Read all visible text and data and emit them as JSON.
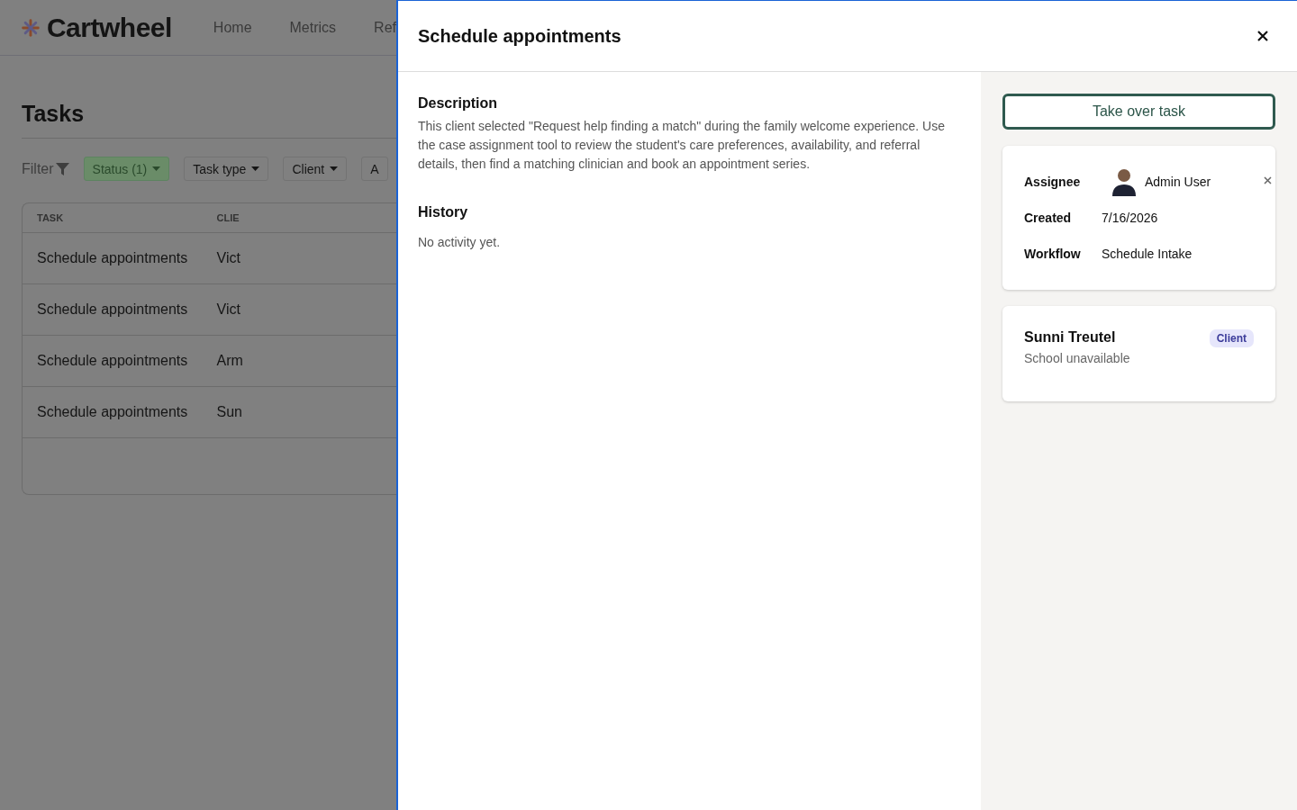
{
  "app": {
    "logo": "Cartwheel",
    "nav": [
      {
        "label": "Home",
        "selected": false
      },
      {
        "label": "Metrics",
        "selected": false
      },
      {
        "label": "Ref",
        "selected": false
      }
    ]
  },
  "page": {
    "title": "Tasks",
    "filter_label": "Filter",
    "filters": [
      {
        "label": "Status (1)",
        "selected": true
      },
      {
        "label": "Task type",
        "selected": false
      },
      {
        "label": "Client",
        "selected": false
      },
      {
        "label": "A",
        "selected": false
      }
    ],
    "table": {
      "columns": [
        "TASK",
        "CLIE"
      ],
      "rows": [
        [
          "Schedule appointments",
          "Vict"
        ],
        [
          "Schedule appointments",
          "Vict"
        ],
        [
          "Schedule appointments",
          "Arm"
        ],
        [
          "Schedule appointments",
          "Sun"
        ]
      ]
    }
  },
  "drawer": {
    "title": "Schedule appointments",
    "description_heading": "Description",
    "description": "This client selected \"Request help finding a match\" during the family welcome experience. Use the case assignment tool to review the student's care preferences, availability, and referral details, then find a matching clinician and book an appointment series.",
    "history_heading": "History",
    "history_empty": "No activity yet.",
    "action": "Take over task",
    "details": [
      {
        "kind": "person",
        "label": "Assignee",
        "value": "Admin User"
      },
      {
        "kind": "text",
        "label": "Created",
        "value": "7/16/2026"
      },
      {
        "kind": "text",
        "label": "Workflow",
        "value": "Schedule Intake"
      }
    ],
    "client": {
      "name": "Sunni Treutel",
      "badge": "Client",
      "subtitle": "School unavailable"
    }
  }
}
